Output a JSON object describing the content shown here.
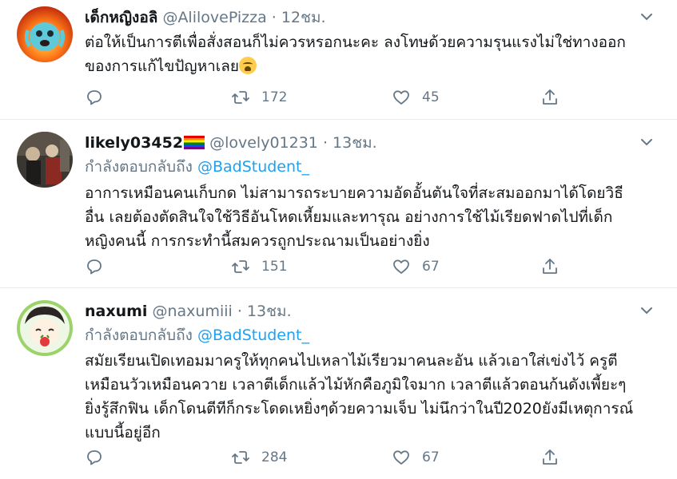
{
  "tweets": [
    {
      "name": "เด็กหญิงอลิ",
      "handle": "@AlilovePizza",
      "separator": "·",
      "time": "12ชม.",
      "text_line1": "ต่อให้เป็นการตีเพื่อสั่งสอนก็ไม่ควรหรอกนะคะ ลงโทษด้วยความรุนแรงไม่ใช่ทางออก",
      "text_line2": "ของการแก้ไขปัญหาเลย",
      "emoji_icon": "loudly-crying-face-icon",
      "retweets": "172",
      "likes": "45"
    },
    {
      "name": "likely03452",
      "flag_icon": "rainbow-flag-icon",
      "handle": "@lovely01231",
      "separator": "·",
      "time": "13ชม.",
      "reply_prefix": "กำลังตอบกลับถึง",
      "reply_to": "@BadStudent_",
      "text_line1": "อาการเหมือนคนเก็บกด ไม่สามารถระบายความอัดอั้นตันใจที่สะสมออกมาได้โดยวิธี",
      "text_line2": "อื่น เลยต้องตัดสินใจใช้วิธีอันโหดเหี้ยมและทารุณ อย่างการใช้ไม้เรียดฟาดไปที่เด็ก",
      "text_line3": "หญิงคนนี้ การกระทำนี้สมควรถูกประณามเป็นอย่างยิ่ง",
      "retweets": "151",
      "likes": "67"
    },
    {
      "name": "naxumi",
      "handle": "@naxumiii",
      "separator": "·",
      "time": "13ชม.",
      "reply_prefix": "กำลังตอบกลับถึง",
      "reply_to": "@BadStudent_",
      "text_line1": "สมัยเรียนเปิดเทอมมาครูให้ทุกคนไปเหลาไม้เรียวมาคนละอัน แล้วเอาใส่เข่งไว้ ครูตี",
      "text_line2": "เหมือนวัวเหมือนควาย เวลาตีเด็กแล้วไม้หักคือภูมิใจมาก เวลาตีแล้วตอนก้นดังเพี้ยะๆ",
      "text_line3": "ยิ่งรู้สึกฟิน เด็กโดนตีทีก็กระโดดเหยิ่งๆด้วยความเจ็บ ไม่นึกว่าในปี2020ยังมีเหตุการณ์",
      "text_line4": "แบบนี้อยู่อีก",
      "retweets": "284",
      "likes": "67"
    }
  ],
  "icons": {
    "reply": "reply-icon",
    "retweet": "retweet-icon",
    "like": "heart-icon",
    "share": "share-icon",
    "more": "chevron-down-icon"
  },
  "colors": {
    "text": "#14171a",
    "secondary": "#657786",
    "link": "#1da1f2",
    "divider": "#e6ecf0"
  }
}
